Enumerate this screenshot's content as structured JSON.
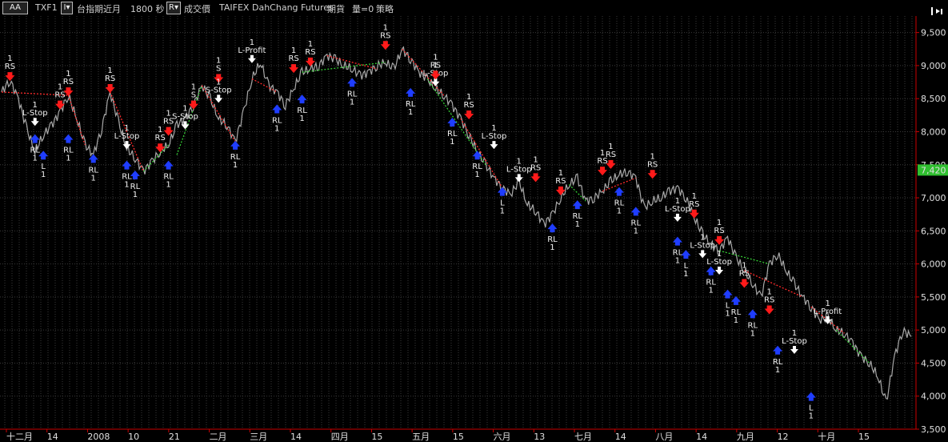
{
  "toolbar": {
    "workspace_label": "AA",
    "symbol": "TXF1",
    "interval_button": "I▾",
    "product_name": "台指期近月",
    "interval": "1800 秒",
    "r_button": "R▾",
    "price_type": "成交價",
    "exchange": "TAIFEX",
    "broker": "DahChang Futures",
    "market": "期貨",
    "volume": "量=0",
    "strategy": "策略"
  },
  "colors": {
    "background": "#000000",
    "grid": "#3a3a3a",
    "axis_line": "#cc0000",
    "price_line": "#a9a9a9",
    "long_trade": "#33cc33",
    "short_trade": "#ff2a2a",
    "buy_marker": "#1f3dff",
    "sell_marker": "#ff1a1a",
    "last_price_badge": "#2fbf2f"
  },
  "chart_data": {
    "type": "line",
    "title": "",
    "xlabel": "",
    "ylabel": "",
    "ylim": [
      3500,
      9750
    ],
    "grid": true,
    "y_ticks": [
      "9,500",
      "9,000",
      "8,500",
      "8,000",
      "7,500",
      "7,000",
      "6,500",
      "6,000",
      "5,500",
      "5,000",
      "4,500",
      "4,000",
      "3,500"
    ],
    "x_tick_labels": [
      "十二月",
      "14",
      "2008",
      "10",
      "21",
      "二月",
      "三月",
      "14",
      "四月",
      "15",
      "五月",
      "15",
      "六月",
      "13",
      "七月",
      "14",
      "八月",
      "14",
      "九月",
      "12",
      "十月",
      "15"
    ],
    "last_price": "7,420",
    "series": [
      {
        "values": [
          8600,
          8780,
          8500,
          8050,
          7700,
          7950,
          8100,
          8300,
          8550,
          8200,
          7800,
          7650,
          8050,
          8600,
          8150,
          7750,
          7600,
          7400,
          7550,
          7700,
          7800,
          8100,
          8200,
          8400,
          8700,
          8500,
          8200,
          8100,
          7850,
          8300,
          8800,
          9050,
          8700,
          8600,
          8400,
          8650,
          8900,
          8950,
          9000,
          9150,
          9100,
          9000,
          8950,
          8850,
          8900,
          9000,
          9050,
          8950,
          9250,
          9100,
          8900,
          8800,
          8650,
          8550,
          8400,
          8200,
          7950,
          7700,
          7500,
          7300,
          7150,
          7050,
          7250,
          6900,
          6800,
          6600,
          6750,
          7000,
          7200,
          7300,
          6950,
          7000,
          7100,
          7250,
          7350,
          7400,
          7300,
          6850,
          6950,
          7000,
          7100,
          7150,
          7000,
          6700,
          6450,
          6300,
          6200,
          6400,
          6100,
          5900,
          5700,
          5500,
          6000,
          6150,
          5900,
          5700,
          5500,
          5350,
          5150,
          5200,
          5000,
          4950,
          4800,
          4600,
          4500,
          4300,
          3900,
          4600,
          5000,
          4900
        ]
      }
    ],
    "trade_segments": [
      {
        "side": "short",
        "from": [
          0,
          8600
        ],
        "to": [
          8,
          8550
        ]
      },
      {
        "side": "short",
        "from": [
          8,
          8550
        ],
        "to": [
          10,
          7800
        ]
      },
      {
        "side": "short",
        "from": [
          13,
          8600
        ],
        "to": [
          17,
          7400
        ]
      },
      {
        "side": "long",
        "from": [
          17,
          7400
        ],
        "to": [
          20,
          7800
        ]
      },
      {
        "side": "long",
        "from": [
          21,
          7650
        ],
        "to": [
          24,
          8700
        ]
      },
      {
        "side": "short",
        "from": [
          24,
          8700
        ],
        "to": [
          28,
          7850
        ]
      },
      {
        "side": "short",
        "from": [
          30,
          8800
        ],
        "to": [
          33,
          8600
        ]
      },
      {
        "side": "long",
        "from": [
          36,
          8900
        ],
        "to": [
          46,
          9050
        ]
      },
      {
        "side": "short",
        "from": [
          39,
          9150
        ],
        "to": [
          45,
          8950
        ]
      },
      {
        "side": "short",
        "from": [
          48,
          9250
        ],
        "to": [
          53,
          8550
        ]
      },
      {
        "side": "long",
        "from": [
          51,
          8800
        ],
        "to": [
          58,
          7500
        ]
      },
      {
        "side": "short",
        "from": [
          55,
          8200
        ],
        "to": [
          60,
          7150
        ]
      },
      {
        "side": "long",
        "from": [
          68,
          7200
        ],
        "to": [
          70,
          6950
        ]
      },
      {
        "side": "short",
        "from": [
          72,
          7100
        ],
        "to": [
          76,
          7300
        ]
      },
      {
        "side": "long",
        "from": [
          86,
          6200
        ],
        "to": [
          92,
          6000
        ]
      },
      {
        "side": "short",
        "from": [
          89,
          5900
        ],
        "to": [
          96,
          5500
        ]
      },
      {
        "side": "long",
        "from": [
          100,
          5000
        ],
        "to": [
          104,
          4500
        ]
      },
      {
        "side": "short",
        "from": [
          97,
          5350
        ],
        "to": [
          101,
          4950
        ]
      }
    ],
    "signals": [
      {
        "label": "RS",
        "qty": "1",
        "type": "sell",
        "pos": [
          1,
          8780
        ]
      },
      {
        "label": "L-Stop",
        "qty": "1",
        "type": "exit",
        "pos": [
          4,
          8100
        ]
      },
      {
        "label": "RS",
        "qty": "1",
        "type": "sell",
        "pos": [
          7,
          8350
        ]
      },
      {
        "label": "RS",
        "qty": "1",
        "type": "sell",
        "pos": [
          8,
          8550
        ]
      },
      {
        "label": "RL",
        "qty": "1",
        "type": "buy",
        "pos": [
          4,
          7950
        ]
      },
      {
        "label": "RL",
        "qty": "1",
        "type": "buy",
        "pos": [
          8,
          7950
        ]
      },
      {
        "label": "L",
        "qty": "1",
        "type": "buy",
        "pos": [
          5,
          7700
        ]
      },
      {
        "label": "RL",
        "qty": "1",
        "type": "buy",
        "pos": [
          11,
          7650
        ]
      },
      {
        "label": "RS",
        "qty": "1",
        "type": "sell",
        "pos": [
          13,
          8600
        ]
      },
      {
        "label": "L-Stop",
        "qty": "1",
        "type": "exit",
        "pos": [
          15,
          7750
        ]
      },
      {
        "label": "RL",
        "qty": "1",
        "type": "buy",
        "pos": [
          15,
          7550
        ]
      },
      {
        "label": "RL",
        "qty": "1",
        "type": "buy",
        "pos": [
          16,
          7400
        ]
      },
      {
        "label": "RS",
        "qty": "1",
        "type": "sell",
        "pos": [
          19,
          7700
        ]
      },
      {
        "label": "RL",
        "qty": "1",
        "type": "buy",
        "pos": [
          20,
          7550
        ]
      },
      {
        "label": "RS",
        "qty": "1",
        "type": "sell",
        "pos": [
          20,
          7950
        ]
      },
      {
        "label": "S-Stop",
        "qty": "1",
        "type": "exit",
        "pos": [
          22,
          8050
        ]
      },
      {
        "label": "S",
        "qty": "1",
        "type": "sell",
        "pos": [
          23,
          8350
        ]
      },
      {
        "label": "S",
        "qty": "1",
        "type": "sell",
        "pos": [
          26,
          8750
        ]
      },
      {
        "label": "S-Stop",
        "qty": "1",
        "type": "exit",
        "pos": [
          26,
          8450
        ]
      },
      {
        "label": "RL",
        "qty": "1",
        "type": "buy",
        "pos": [
          28,
          7850
        ]
      },
      {
        "label": "L-Profit",
        "qty": "1",
        "type": "exit",
        "pos": [
          30,
          9050
        ]
      },
      {
        "label": "RL",
        "qty": "1",
        "type": "buy",
        "pos": [
          33,
          8400
        ]
      },
      {
        "label": "RS",
        "qty": "1",
        "type": "sell",
        "pos": [
          35,
          8900
        ]
      },
      {
        "label": "RL",
        "qty": "1",
        "type": "buy",
        "pos": [
          36,
          8550
        ]
      },
      {
        "label": "RS",
        "qty": "1",
        "type": "sell",
        "pos": [
          37,
          9000
        ]
      },
      {
        "label": "RL",
        "qty": "1",
        "type": "buy",
        "pos": [
          42,
          8800
        ]
      },
      {
        "label": "RS",
        "qty": "1",
        "type": "sell",
        "pos": [
          46,
          9250
        ]
      },
      {
        "label": "RL",
        "qty": "1",
        "type": "buy",
        "pos": [
          49,
          8650
        ]
      },
      {
        "label": "L-Stop",
        "qty": "1",
        "type": "exit",
        "pos": [
          52,
          8700
        ]
      },
      {
        "label": "RS",
        "qty": "1",
        "type": "sell",
        "pos": [
          52,
          8800
        ]
      },
      {
        "label": "RL",
        "qty": "1",
        "type": "buy",
        "pos": [
          54,
          8200
        ]
      },
      {
        "label": "RS",
        "qty": "1",
        "type": "sell",
        "pos": [
          56,
          8200
        ]
      },
      {
        "label": "L-Stop",
        "qty": "1",
        "type": "exit",
        "pos": [
          59,
          7750
        ]
      },
      {
        "label": "RL",
        "qty": "1",
        "type": "buy",
        "pos": [
          57,
          7700
        ]
      },
      {
        "label": "L",
        "qty": "1",
        "type": "buy",
        "pos": [
          60,
          7150
        ]
      },
      {
        "label": "L-Stop",
        "qty": "1",
        "type": "exit",
        "pos": [
          62,
          7250
        ]
      },
      {
        "label": "RS",
        "qty": "1",
        "type": "sell",
        "pos": [
          64,
          7250
        ]
      },
      {
        "label": "RL",
        "qty": "1",
        "type": "buy",
        "pos": [
          66,
          6600
        ]
      },
      {
        "label": "RS",
        "qty": "1",
        "type": "sell",
        "pos": [
          67,
          7050
        ]
      },
      {
        "label": "RL",
        "qty": "1",
        "type": "buy",
        "pos": [
          69,
          6950
        ]
      },
      {
        "label": "RS",
        "qty": "1",
        "type": "sell",
        "pos": [
          72,
          7350
        ]
      },
      {
        "label": "RS",
        "qty": "1",
        "type": "sell",
        "pos": [
          73,
          7450
        ]
      },
      {
        "label": "RL",
        "qty": "1",
        "type": "buy",
        "pos": [
          74,
          7150
        ]
      },
      {
        "label": "RL",
        "qty": "1",
        "type": "buy",
        "pos": [
          76,
          6850
        ]
      },
      {
        "label": "RS",
        "qty": "1",
        "type": "sell",
        "pos": [
          78,
          7300
        ]
      },
      {
        "label": "L-Stop",
        "qty": "1",
        "type": "exit",
        "pos": [
          81,
          6650
        ]
      },
      {
        "label": "RS",
        "qty": "1",
        "type": "sell",
        "pos": [
          83,
          6700
        ]
      },
      {
        "label": "RL",
        "qty": "1",
        "type": "buy",
        "pos": [
          81,
          6400
        ]
      },
      {
        "label": "L",
        "qty": "1",
        "type": "buy",
        "pos": [
          82,
          6200
        ]
      },
      {
        "label": "L-Stop",
        "qty": "1",
        "type": "exit",
        "pos": [
          84,
          6100
        ]
      },
      {
        "label": "RS",
        "qty": "1",
        "type": "sell",
        "pos": [
          86,
          6300
        ]
      },
      {
        "label": "RL",
        "qty": "1",
        "type": "buy",
        "pos": [
          85,
          5950
        ]
      },
      {
        "label": "L-Stop",
        "qty": "1",
        "type": "exit",
        "pos": [
          86,
          5850
        ]
      },
      {
        "label": "L",
        "qty": "1",
        "type": "buy",
        "pos": [
          87,
          5600
        ]
      },
      {
        "label": "RS",
        "qty": "1",
        "type": "sell",
        "pos": [
          89,
          5650
        ]
      },
      {
        "label": "RL",
        "qty": "1",
        "type": "buy",
        "pos": [
          88,
          5500
        ]
      },
      {
        "label": "RL",
        "qty": "1",
        "type": "buy",
        "pos": [
          90,
          5300
        ]
      },
      {
        "label": "L-Stop",
        "qty": "1",
        "type": "exit",
        "pos": [
          95,
          4650
        ]
      },
      {
        "label": "RS",
        "qty": "1",
        "type": "sell",
        "pos": [
          92,
          5250
        ]
      },
      {
        "label": "RL",
        "qty": "1",
        "type": "buy",
        "pos": [
          93,
          4750
        ]
      },
      {
        "label": "L",
        "qty": "1",
        "type": "buy",
        "pos": [
          97,
          4050
        ]
      },
      {
        "label": "L-Profit",
        "qty": "1",
        "type": "exit",
        "pos": [
          99,
          5100
        ]
      }
    ]
  }
}
